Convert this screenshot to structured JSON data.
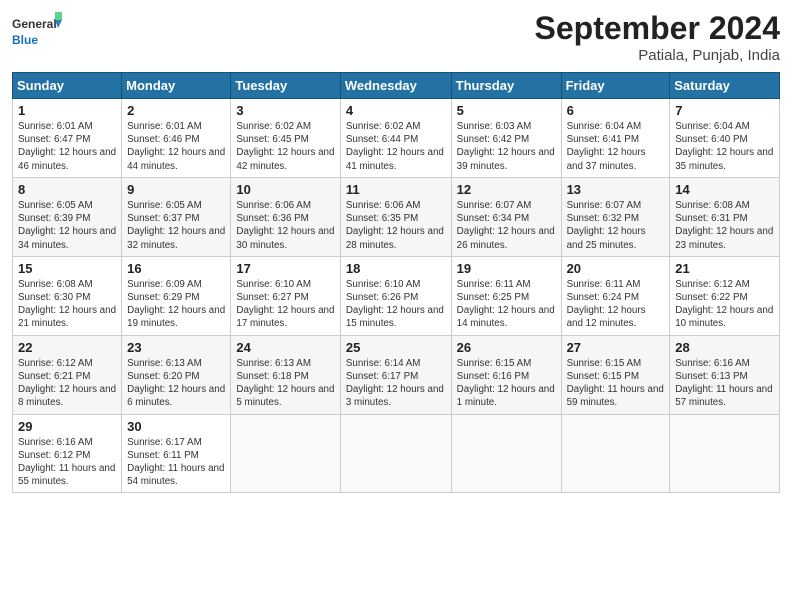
{
  "header": {
    "logo": {
      "general": "General",
      "blue": "Blue"
    },
    "title": "September 2024",
    "location": "Patiala, Punjab, India"
  },
  "days_of_week": [
    "Sunday",
    "Monday",
    "Tuesday",
    "Wednesday",
    "Thursday",
    "Friday",
    "Saturday"
  ],
  "weeks": [
    [
      {
        "num": "1",
        "sunrise": "Sunrise: 6:01 AM",
        "sunset": "Sunset: 6:47 PM",
        "daylight": "Daylight: 12 hours and 46 minutes."
      },
      {
        "num": "2",
        "sunrise": "Sunrise: 6:01 AM",
        "sunset": "Sunset: 6:46 PM",
        "daylight": "Daylight: 12 hours and 44 minutes."
      },
      {
        "num": "3",
        "sunrise": "Sunrise: 6:02 AM",
        "sunset": "Sunset: 6:45 PM",
        "daylight": "Daylight: 12 hours and 42 minutes."
      },
      {
        "num": "4",
        "sunrise": "Sunrise: 6:02 AM",
        "sunset": "Sunset: 6:44 PM",
        "daylight": "Daylight: 12 hours and 41 minutes."
      },
      {
        "num": "5",
        "sunrise": "Sunrise: 6:03 AM",
        "sunset": "Sunset: 6:42 PM",
        "daylight": "Daylight: 12 hours and 39 minutes."
      },
      {
        "num": "6",
        "sunrise": "Sunrise: 6:04 AM",
        "sunset": "Sunset: 6:41 PM",
        "daylight": "Daylight: 12 hours and 37 minutes."
      },
      {
        "num": "7",
        "sunrise": "Sunrise: 6:04 AM",
        "sunset": "Sunset: 6:40 PM",
        "daylight": "Daylight: 12 hours and 35 minutes."
      }
    ],
    [
      {
        "num": "8",
        "sunrise": "Sunrise: 6:05 AM",
        "sunset": "Sunset: 6:39 PM",
        "daylight": "Daylight: 12 hours and 34 minutes."
      },
      {
        "num": "9",
        "sunrise": "Sunrise: 6:05 AM",
        "sunset": "Sunset: 6:37 PM",
        "daylight": "Daylight: 12 hours and 32 minutes."
      },
      {
        "num": "10",
        "sunrise": "Sunrise: 6:06 AM",
        "sunset": "Sunset: 6:36 PM",
        "daylight": "Daylight: 12 hours and 30 minutes."
      },
      {
        "num": "11",
        "sunrise": "Sunrise: 6:06 AM",
        "sunset": "Sunset: 6:35 PM",
        "daylight": "Daylight: 12 hours and 28 minutes."
      },
      {
        "num": "12",
        "sunrise": "Sunrise: 6:07 AM",
        "sunset": "Sunset: 6:34 PM",
        "daylight": "Daylight: 12 hours and 26 minutes."
      },
      {
        "num": "13",
        "sunrise": "Sunrise: 6:07 AM",
        "sunset": "Sunset: 6:32 PM",
        "daylight": "Daylight: 12 hours and 25 minutes."
      },
      {
        "num": "14",
        "sunrise": "Sunrise: 6:08 AM",
        "sunset": "Sunset: 6:31 PM",
        "daylight": "Daylight: 12 hours and 23 minutes."
      }
    ],
    [
      {
        "num": "15",
        "sunrise": "Sunrise: 6:08 AM",
        "sunset": "Sunset: 6:30 PM",
        "daylight": "Daylight: 12 hours and 21 minutes."
      },
      {
        "num": "16",
        "sunrise": "Sunrise: 6:09 AM",
        "sunset": "Sunset: 6:29 PM",
        "daylight": "Daylight: 12 hours and 19 minutes."
      },
      {
        "num": "17",
        "sunrise": "Sunrise: 6:10 AM",
        "sunset": "Sunset: 6:27 PM",
        "daylight": "Daylight: 12 hours and 17 minutes."
      },
      {
        "num": "18",
        "sunrise": "Sunrise: 6:10 AM",
        "sunset": "Sunset: 6:26 PM",
        "daylight": "Daylight: 12 hours and 15 minutes."
      },
      {
        "num": "19",
        "sunrise": "Sunrise: 6:11 AM",
        "sunset": "Sunset: 6:25 PM",
        "daylight": "Daylight: 12 hours and 14 minutes."
      },
      {
        "num": "20",
        "sunrise": "Sunrise: 6:11 AM",
        "sunset": "Sunset: 6:24 PM",
        "daylight": "Daylight: 12 hours and 12 minutes."
      },
      {
        "num": "21",
        "sunrise": "Sunrise: 6:12 AM",
        "sunset": "Sunset: 6:22 PM",
        "daylight": "Daylight: 12 hours and 10 minutes."
      }
    ],
    [
      {
        "num": "22",
        "sunrise": "Sunrise: 6:12 AM",
        "sunset": "Sunset: 6:21 PM",
        "daylight": "Daylight: 12 hours and 8 minutes."
      },
      {
        "num": "23",
        "sunrise": "Sunrise: 6:13 AM",
        "sunset": "Sunset: 6:20 PM",
        "daylight": "Daylight: 12 hours and 6 minutes."
      },
      {
        "num": "24",
        "sunrise": "Sunrise: 6:13 AM",
        "sunset": "Sunset: 6:18 PM",
        "daylight": "Daylight: 12 hours and 5 minutes."
      },
      {
        "num": "25",
        "sunrise": "Sunrise: 6:14 AM",
        "sunset": "Sunset: 6:17 PM",
        "daylight": "Daylight: 12 hours and 3 minutes."
      },
      {
        "num": "26",
        "sunrise": "Sunrise: 6:15 AM",
        "sunset": "Sunset: 6:16 PM",
        "daylight": "Daylight: 12 hours and 1 minute."
      },
      {
        "num": "27",
        "sunrise": "Sunrise: 6:15 AM",
        "sunset": "Sunset: 6:15 PM",
        "daylight": "Daylight: 11 hours and 59 minutes."
      },
      {
        "num": "28",
        "sunrise": "Sunrise: 6:16 AM",
        "sunset": "Sunset: 6:13 PM",
        "daylight": "Daylight: 11 hours and 57 minutes."
      }
    ],
    [
      {
        "num": "29",
        "sunrise": "Sunrise: 6:16 AM",
        "sunset": "Sunset: 6:12 PM",
        "daylight": "Daylight: 11 hours and 55 minutes."
      },
      {
        "num": "30",
        "sunrise": "Sunrise: 6:17 AM",
        "sunset": "Sunset: 6:11 PM",
        "daylight": "Daylight: 11 hours and 54 minutes."
      },
      null,
      null,
      null,
      null,
      null
    ]
  ]
}
